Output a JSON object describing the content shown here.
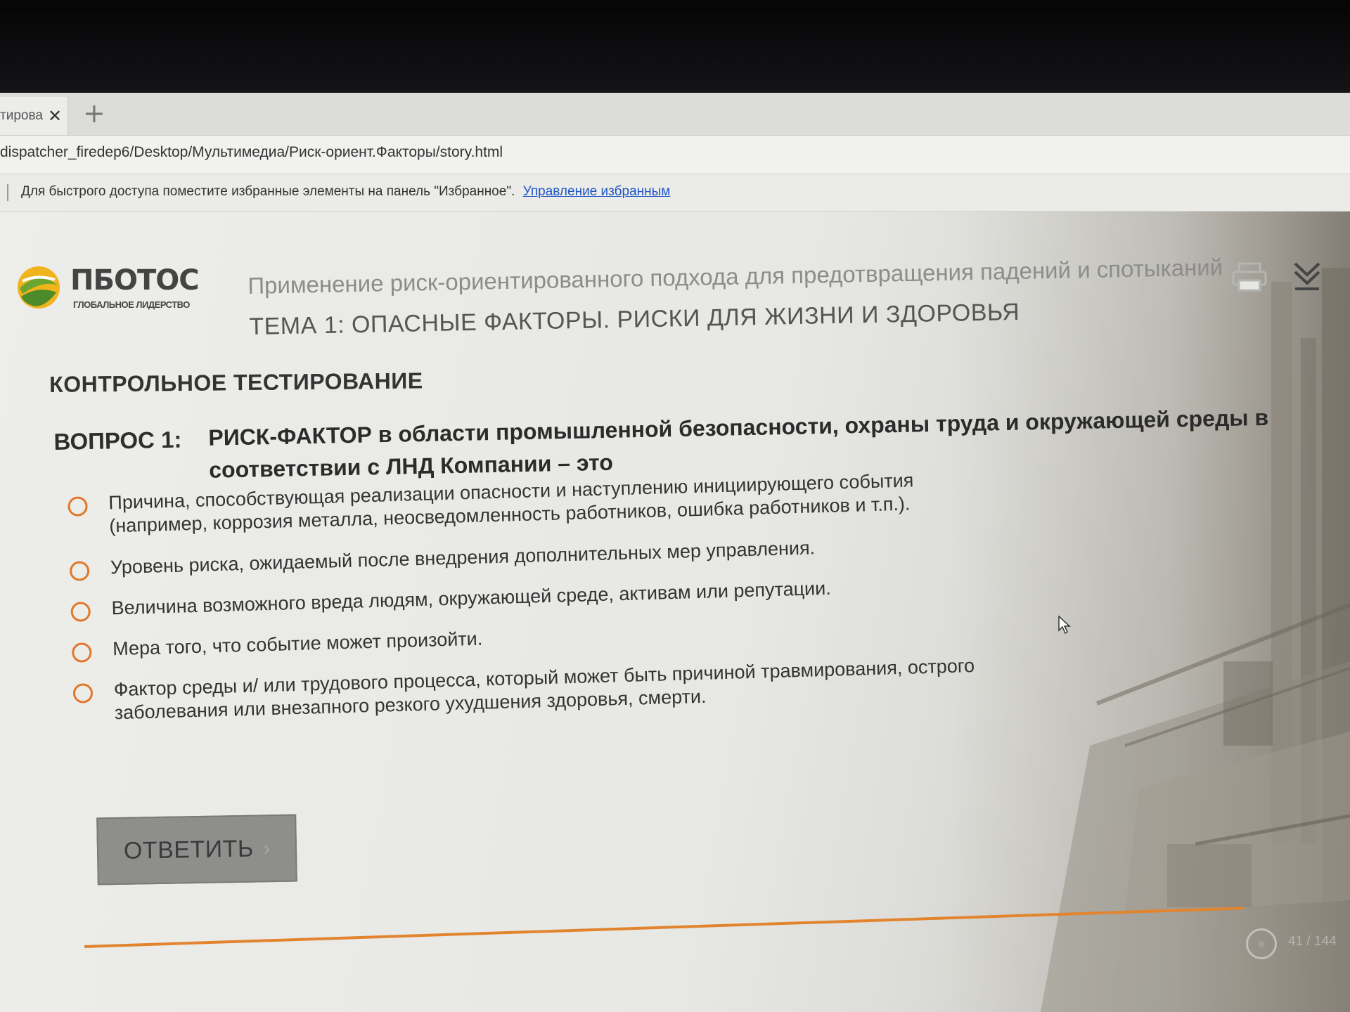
{
  "browser": {
    "tab_title": "тирован",
    "tab_close": "✕",
    "new_tab": "+",
    "url": "dispatcher_firedep6/Desktop/Мультимедиа/Риск-ориент.Факторы/story.html",
    "favorites_hint": "Для быстрого доступа поместите избранные элементы на панель \"Избранное\".",
    "favorites_link": "Управление избранным"
  },
  "header": {
    "logo_name": "ПБОТОС",
    "logo_subtitle": "ГЛОБАЛЬНОЕ ЛИДЕРСТВО",
    "course_title": "Применение риск-ориентированного подхода для предотвращения падений и спотыканий",
    "topic_title": "ТЕМА 1: ОПАСНЫЕ ФАКТОРЫ. РИСКИ ДЛЯ ЖИЗНИ И ЗДОРОВЬЯ"
  },
  "quiz": {
    "section_heading": "КОНТРОЛЬНОЕ ТЕСТИРОВАНИЕ",
    "question_number": "ВОПРОС 1:",
    "question_text": "РИСК-ФАКТОР в области промышленной безопасности, охраны труда и окружающей среды в соответствии с ЛНД Компании – это",
    "options": [
      {
        "label": "Причина, способствующая реализации опасности и наступлению инициирующего события (например, коррозия металла, неосведомленность работников, ошибка работников и т.п.).",
        "selected": false
      },
      {
        "label": "Уровень риска, ожидаемый после внедрения дополнительных мер управления.",
        "selected": false
      },
      {
        "label": "Величина возможного вреда людям, окружающей среде, активам или репутации.",
        "selected": false
      },
      {
        "label": "Мера того, что событие может произойти.",
        "selected": false
      },
      {
        "label": "Фактор среды и/ или трудового процесса, который может быть причиной травмирования, острого заболевания или внезапного резкого ухудшения здоровья, смерти.",
        "selected": false
      }
    ],
    "answer_button": "ОТВЕТИТЬ",
    "answer_arrow": "›"
  },
  "navigation": {
    "prev_icon": "«",
    "page_counter": "41 / 144",
    "accent_color": "#e2772a"
  }
}
